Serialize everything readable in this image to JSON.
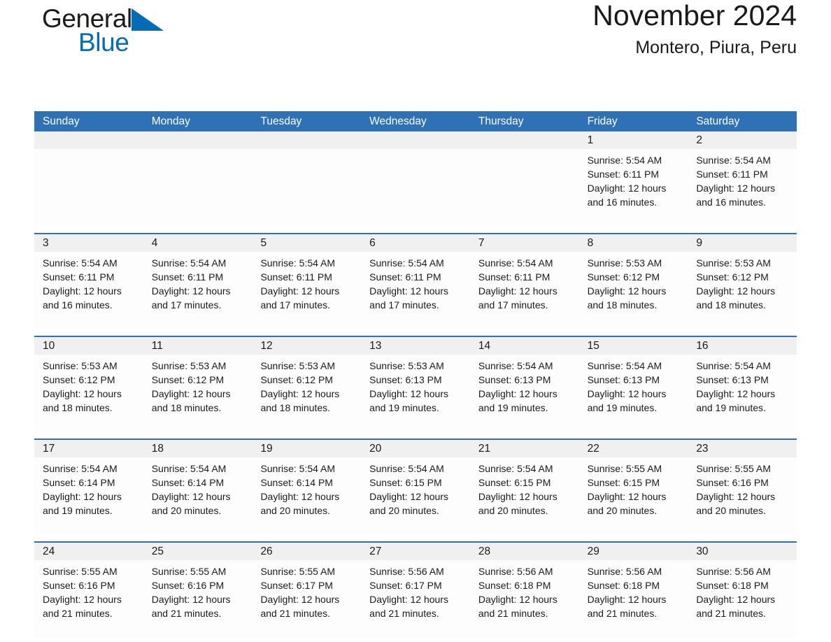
{
  "brand": {
    "word_general": "General",
    "word_blue": "Blue",
    "triangle_icon": "triangle-logo-icon",
    "color_blue": "#046bb6"
  },
  "header": {
    "title": "November 2024",
    "subtitle": "Montero, Piura, Peru"
  },
  "colors": {
    "header_blue": "#2e71b4",
    "date_band_gray": "#f0f0f0",
    "text": "#1a1a1a"
  },
  "weekdays": [
    "Sunday",
    "Monday",
    "Tuesday",
    "Wednesday",
    "Thursday",
    "Friday",
    "Saturday"
  ],
  "weeks": [
    {
      "days": [
        {
          "date": "",
          "lines": []
        },
        {
          "date": "",
          "lines": []
        },
        {
          "date": "",
          "lines": []
        },
        {
          "date": "",
          "lines": []
        },
        {
          "date": "",
          "lines": []
        },
        {
          "date": "1",
          "lines": [
            "Sunrise: 5:54 AM",
            "Sunset: 6:11 PM",
            "Daylight: 12 hours",
            "and 16 minutes."
          ]
        },
        {
          "date": "2",
          "lines": [
            "Sunrise: 5:54 AM",
            "Sunset: 6:11 PM",
            "Daylight: 12 hours",
            "and 16 minutes."
          ]
        }
      ]
    },
    {
      "days": [
        {
          "date": "3",
          "lines": [
            "Sunrise: 5:54 AM",
            "Sunset: 6:11 PM",
            "Daylight: 12 hours",
            "and 16 minutes."
          ]
        },
        {
          "date": "4",
          "lines": [
            "Sunrise: 5:54 AM",
            "Sunset: 6:11 PM",
            "Daylight: 12 hours",
            "and 17 minutes."
          ]
        },
        {
          "date": "5",
          "lines": [
            "Sunrise: 5:54 AM",
            "Sunset: 6:11 PM",
            "Daylight: 12 hours",
            "and 17 minutes."
          ]
        },
        {
          "date": "6",
          "lines": [
            "Sunrise: 5:54 AM",
            "Sunset: 6:11 PM",
            "Daylight: 12 hours",
            "and 17 minutes."
          ]
        },
        {
          "date": "7",
          "lines": [
            "Sunrise: 5:54 AM",
            "Sunset: 6:11 PM",
            "Daylight: 12 hours",
            "and 17 minutes."
          ]
        },
        {
          "date": "8",
          "lines": [
            "Sunrise: 5:53 AM",
            "Sunset: 6:12 PM",
            "Daylight: 12 hours",
            "and 18 minutes."
          ]
        },
        {
          "date": "9",
          "lines": [
            "Sunrise: 5:53 AM",
            "Sunset: 6:12 PM",
            "Daylight: 12 hours",
            "and 18 minutes."
          ]
        }
      ]
    },
    {
      "days": [
        {
          "date": "10",
          "lines": [
            "Sunrise: 5:53 AM",
            "Sunset: 6:12 PM",
            "Daylight: 12 hours",
            "and 18 minutes."
          ]
        },
        {
          "date": "11",
          "lines": [
            "Sunrise: 5:53 AM",
            "Sunset: 6:12 PM",
            "Daylight: 12 hours",
            "and 18 minutes."
          ]
        },
        {
          "date": "12",
          "lines": [
            "Sunrise: 5:53 AM",
            "Sunset: 6:12 PM",
            "Daylight: 12 hours",
            "and 18 minutes."
          ]
        },
        {
          "date": "13",
          "lines": [
            "Sunrise: 5:53 AM",
            "Sunset: 6:13 PM",
            "Daylight: 12 hours",
            "and 19 minutes."
          ]
        },
        {
          "date": "14",
          "lines": [
            "Sunrise: 5:54 AM",
            "Sunset: 6:13 PM",
            "Daylight: 12 hours",
            "and 19 minutes."
          ]
        },
        {
          "date": "15",
          "lines": [
            "Sunrise: 5:54 AM",
            "Sunset: 6:13 PM",
            "Daylight: 12 hours",
            "and 19 minutes."
          ]
        },
        {
          "date": "16",
          "lines": [
            "Sunrise: 5:54 AM",
            "Sunset: 6:13 PM",
            "Daylight: 12 hours",
            "and 19 minutes."
          ]
        }
      ]
    },
    {
      "days": [
        {
          "date": "17",
          "lines": [
            "Sunrise: 5:54 AM",
            "Sunset: 6:14 PM",
            "Daylight: 12 hours",
            "and 19 minutes."
          ]
        },
        {
          "date": "18",
          "lines": [
            "Sunrise: 5:54 AM",
            "Sunset: 6:14 PM",
            "Daylight: 12 hours",
            "and 20 minutes."
          ]
        },
        {
          "date": "19",
          "lines": [
            "Sunrise: 5:54 AM",
            "Sunset: 6:14 PM",
            "Daylight: 12 hours",
            "and 20 minutes."
          ]
        },
        {
          "date": "20",
          "lines": [
            "Sunrise: 5:54 AM",
            "Sunset: 6:15 PM",
            "Daylight: 12 hours",
            "and 20 minutes."
          ]
        },
        {
          "date": "21",
          "lines": [
            "Sunrise: 5:54 AM",
            "Sunset: 6:15 PM",
            "Daylight: 12 hours",
            "and 20 minutes."
          ]
        },
        {
          "date": "22",
          "lines": [
            "Sunrise: 5:55 AM",
            "Sunset: 6:15 PM",
            "Daylight: 12 hours",
            "and 20 minutes."
          ]
        },
        {
          "date": "23",
          "lines": [
            "Sunrise: 5:55 AM",
            "Sunset: 6:16 PM",
            "Daylight: 12 hours",
            "and 20 minutes."
          ]
        }
      ]
    },
    {
      "days": [
        {
          "date": "24",
          "lines": [
            "Sunrise: 5:55 AM",
            "Sunset: 6:16 PM",
            "Daylight: 12 hours",
            "and 21 minutes."
          ]
        },
        {
          "date": "25",
          "lines": [
            "Sunrise: 5:55 AM",
            "Sunset: 6:16 PM",
            "Daylight: 12 hours",
            "and 21 minutes."
          ]
        },
        {
          "date": "26",
          "lines": [
            "Sunrise: 5:55 AM",
            "Sunset: 6:17 PM",
            "Daylight: 12 hours",
            "and 21 minutes."
          ]
        },
        {
          "date": "27",
          "lines": [
            "Sunrise: 5:56 AM",
            "Sunset: 6:17 PM",
            "Daylight: 12 hours",
            "and 21 minutes."
          ]
        },
        {
          "date": "28",
          "lines": [
            "Sunrise: 5:56 AM",
            "Sunset: 6:18 PM",
            "Daylight: 12 hours",
            "and 21 minutes."
          ]
        },
        {
          "date": "29",
          "lines": [
            "Sunrise: 5:56 AM",
            "Sunset: 6:18 PM",
            "Daylight: 12 hours",
            "and 21 minutes."
          ]
        },
        {
          "date": "30",
          "lines": [
            "Sunrise: 5:56 AM",
            "Sunset: 6:18 PM",
            "Daylight: 12 hours",
            "and 21 minutes."
          ]
        }
      ]
    }
  ]
}
